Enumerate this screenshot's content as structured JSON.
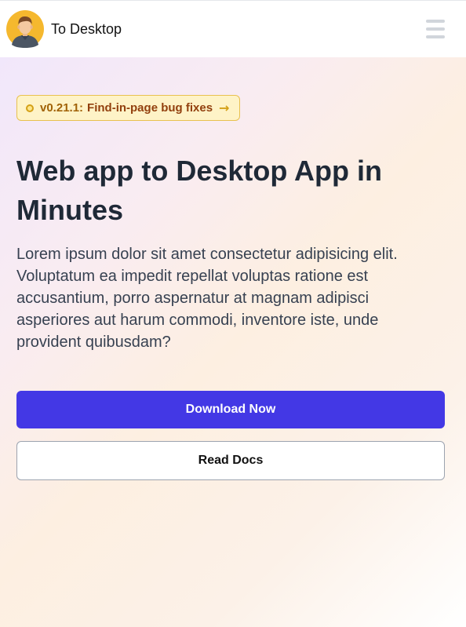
{
  "header": {
    "brand_name": "To Desktop",
    "avatar_icon": "user-avatar-icon",
    "menu_icon": "hamburger-menu-icon"
  },
  "hero": {
    "badge": {
      "version": "v0.21.1",
      "separator": ":",
      "text": "Find-in-page bug fixes",
      "arrow": "→"
    },
    "headline": "Web app to Desktop App in Minutes",
    "description": "Lorem ipsum dolor sit amet consectetur adipisicing elit. Voluptatum ea impedit repellat voluptas ratione est accusantium, porro aspernatur at magnam adipisci asperiores aut harum commodi, inventore iste, unde provident quibusdam?",
    "primary_button": "Download Now",
    "secondary_button": "Read Docs"
  },
  "colors": {
    "primary": "#4338e5",
    "badge_bg": "#fef3c7",
    "badge_border": "#e8c14f",
    "badge_text": "#92400e",
    "heading": "#1f2937",
    "menu_icon": "#d1d5db"
  }
}
